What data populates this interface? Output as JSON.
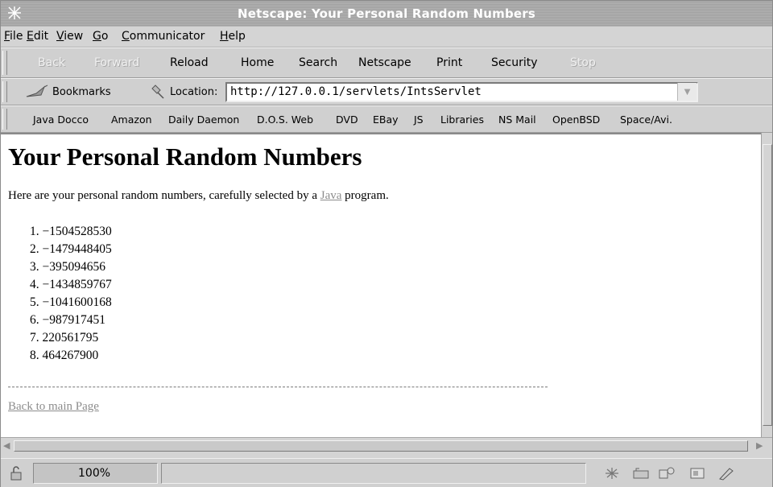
{
  "window": {
    "title": "Netscape: Your Personal Random Numbers"
  },
  "menubar": {
    "items": [
      "File",
      "Edit",
      "View",
      "Go",
      "Communicator",
      "Help"
    ]
  },
  "nav_toolbar": {
    "back": "Back",
    "forward": "Forward",
    "reload": "Reload",
    "home": "Home",
    "search": "Search",
    "netscape": "Netscape",
    "print": "Print",
    "security": "Security",
    "stop": "Stop"
  },
  "location_toolbar": {
    "bookmarks_label": "Bookmarks",
    "location_label": "Location:",
    "url": "http://127.0.0.1/servlets/IntsServlet"
  },
  "personal_toolbar": {
    "items": [
      "Java Docco",
      "Amazon",
      "Daily Daemon",
      "D.O.S. Web",
      "DVD",
      "EBay",
      "JS",
      "Libraries",
      "NS Mail",
      "OpenBSD",
      "Space/Avi."
    ]
  },
  "page": {
    "heading": "Your Personal Random Numbers",
    "intro_before": "Here are your personal random numbers, carefully selected by a ",
    "intro_link": "Java",
    "intro_after": " program.",
    "numbers": [
      {
        "index": "1.",
        "value": "−1504528530"
      },
      {
        "index": "2.",
        "value": "−1479448405"
      },
      {
        "index": "3.",
        "value": "−395094656"
      },
      {
        "index": "4.",
        "value": "−1434859767"
      },
      {
        "index": "5.",
        "value": "−1041600168"
      },
      {
        "index": "6.",
        "value": "−987917451"
      },
      {
        "index": "7.",
        "value": "220561795"
      },
      {
        "index": "8.",
        "value": "464267900"
      }
    ],
    "back_link": "Back to main Page"
  },
  "statusbar": {
    "progress_text": "100%"
  },
  "colors": {
    "chrome": "#d0d0d0",
    "titlebar": "#a9a9a9",
    "link": "#8c8c8c"
  }
}
